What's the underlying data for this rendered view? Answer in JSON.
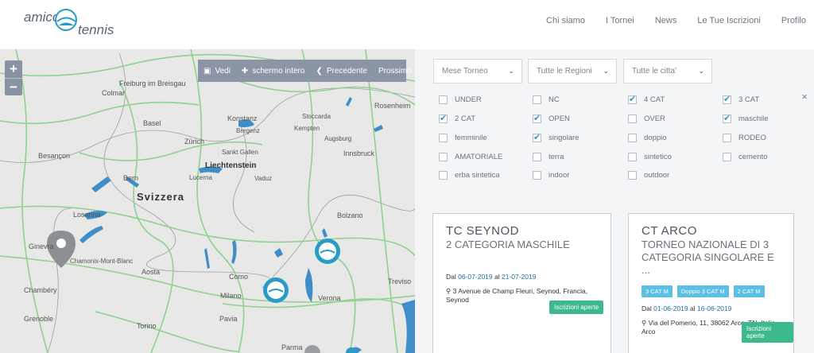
{
  "logo": {
    "part1": "amico",
    "part2": "tennis"
  },
  "nav": [
    "Chi siamo",
    "I Tornei",
    "News",
    "Le Tue Iscrizioni",
    "Profilo"
  ],
  "map": {
    "zoom_in": "+",
    "zoom_out": "−",
    "gallery": {
      "view": "Vedi",
      "fullscreen": "schermo intero",
      "previous": "Precedente",
      "next": "Prossimo"
    },
    "labels": [
      "Colmar",
      "Freiburg im Breisgau",
      "Basel",
      "Zürich",
      "Konstanz",
      "Rosenheim",
      "Besançon",
      "Bern",
      "Svizzera",
      "Liechtenstein",
      "Losanna",
      "Chamonix-Mont-Blanc",
      "Chambéry",
      "Grenoble",
      "Aosta",
      "Como",
      "Milano",
      "Pavia",
      "Torino",
      "Verona",
      "Bolzano",
      "Treviso",
      "Parma",
      "Innsbruck",
      "Stoccarda",
      "Augsburg",
      "Sankt Gallen",
      "Bregenz",
      "Kempten",
      "Vaduz",
      "Lucerna",
      "Ginevra"
    ]
  },
  "filters": {
    "selects": [
      "Mese Torneo",
      "Tutte le Regioni",
      "Tutte le citta'"
    ],
    "checkboxes": [
      {
        "label": "UNDER",
        "checked": false
      },
      {
        "label": "NC",
        "checked": false
      },
      {
        "label": "4 CAT",
        "checked": true
      },
      {
        "label": "3 CAT",
        "checked": true
      },
      {
        "label": "2 CAT",
        "checked": true
      },
      {
        "label": "OPEN",
        "checked": true
      },
      {
        "label": "OVER",
        "checked": false
      },
      {
        "label": "maschile",
        "checked": true
      },
      {
        "label": "femminile",
        "checked": false
      },
      {
        "label": "singolare",
        "checked": true
      },
      {
        "label": "doppio",
        "checked": false
      },
      {
        "label": "RODEO",
        "checked": false
      },
      {
        "label": "AMATORIALE",
        "checked": false
      },
      {
        "label": "terra",
        "checked": false
      },
      {
        "label": "sintetico",
        "checked": false
      },
      {
        "label": "cemento",
        "checked": false
      },
      {
        "label": "erba sintetica",
        "checked": false
      },
      {
        "label": "indoor",
        "checked": false
      },
      {
        "label": "outdoor",
        "checked": false
      }
    ],
    "close": "×"
  },
  "cards": [
    {
      "title": "TC SEYNOD",
      "subtitle": "2 CATEGORIA MASCHILE",
      "tags": [],
      "dal": "Dal",
      "date_from": "06-07-2019",
      "al": "al",
      "date_to": "21-07-2019",
      "address": "3 Avenue de Champ Fleuri, Seynod, Francia, Seynod",
      "status": "Iscrizioni aperte"
    },
    {
      "title": "CT ARCO",
      "subtitle": "TORNEO NAZIONALE DI 3 CATEGORIA SINGOLARE E ...",
      "tags": [
        "3 CAT M",
        "Doppio 3 CAT M",
        "2 CAT M"
      ],
      "dal": "Dal",
      "date_from": "01-06-2019",
      "al": "al",
      "date_to": "16-06-2019",
      "address": "Via del Pomerio, 11, 38062 Arco, TN, Italia, Arco",
      "status": "Iscrizioni aperte"
    }
  ],
  "colors": {
    "accent": "#2a9bc6",
    "status_green": "#3cba8c",
    "tag_blue": "#5bc0e4",
    "lake": "#3f8ec9",
    "road": "#8fd18f"
  }
}
